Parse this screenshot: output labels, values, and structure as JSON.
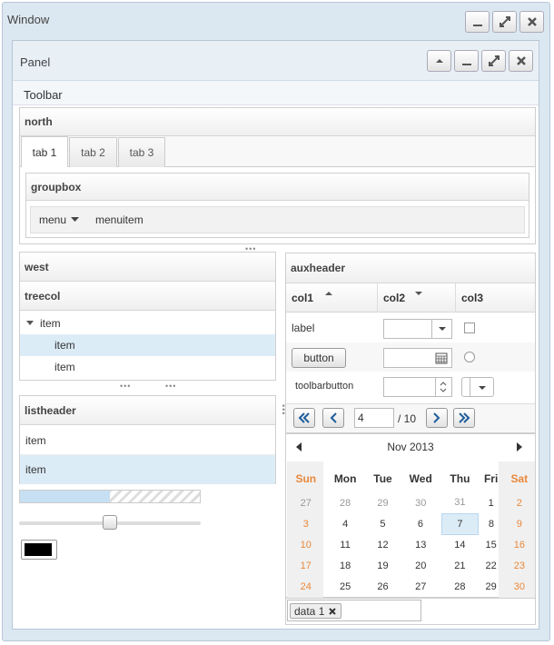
{
  "window": {
    "title": "Window"
  },
  "panel": {
    "title": "Panel",
    "toolbar": "Toolbar"
  },
  "north": {
    "title": "north",
    "tabs": [
      "tab 1",
      "tab 2",
      "tab 3"
    ],
    "groupbox": "groupbox",
    "menu": "menu",
    "menuitem": "menuitem"
  },
  "west": {
    "title": "west",
    "treecol": "treecol",
    "tree": [
      "item",
      "item",
      "item"
    ]
  },
  "listbox": {
    "header": "listheader",
    "items": [
      "item",
      "item"
    ],
    "progress": 0.5,
    "slider": 0.5,
    "color": "#000000"
  },
  "grid": {
    "auxheader": "auxheader",
    "cols": [
      "col1",
      "col2",
      "col3"
    ],
    "label": "label",
    "button": "button",
    "toolbarbutton": "toolbarbutton"
  },
  "paging": {
    "page": "4",
    "of": "/ 10"
  },
  "calendar": {
    "month": "Nov 2013",
    "days": [
      "Sun",
      "Mon",
      "Tue",
      "Wed",
      "Thu",
      "Fri",
      "Sat"
    ],
    "weeks": [
      [
        "27",
        "28",
        "29",
        "30",
        "31",
        "1",
        "2"
      ],
      [
        "3",
        "4",
        "5",
        "6",
        "7",
        "8",
        "9"
      ],
      [
        "10",
        "11",
        "12",
        "13",
        "14",
        "15",
        "16"
      ],
      [
        "17",
        "18",
        "19",
        "20",
        "21",
        "22",
        "23"
      ],
      [
        "24",
        "25",
        "26",
        "27",
        "28",
        "29",
        "30"
      ]
    ],
    "selected": "7"
  },
  "chosenbox": {
    "item": "data 1"
  },
  "colors": {
    "accent": "#1e5d9b",
    "weekend": "#e8883a",
    "selection": "#dcecf7"
  }
}
